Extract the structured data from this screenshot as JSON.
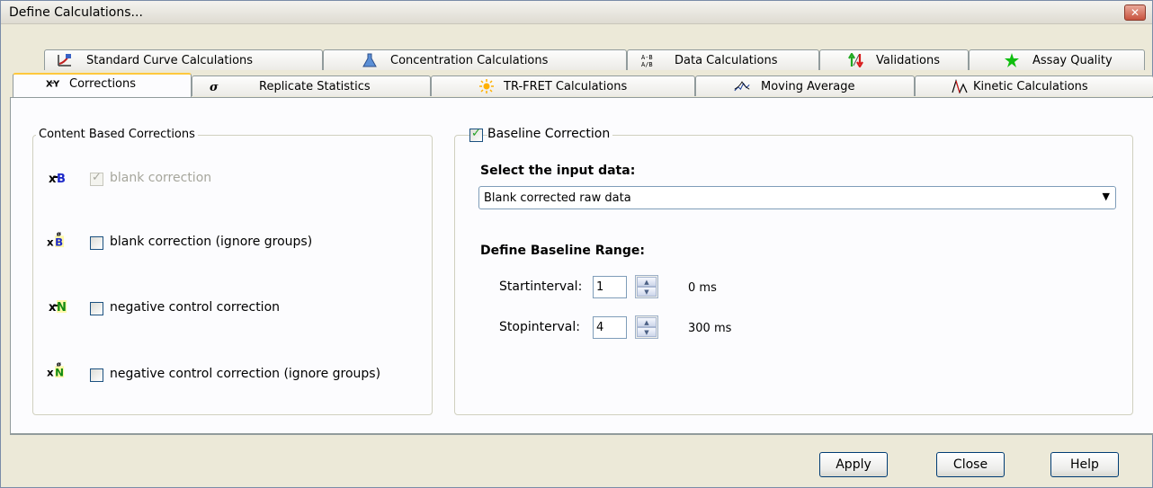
{
  "window": {
    "title": "Define Calculations...",
    "close_glyph": "✕"
  },
  "tabs_row1": [
    {
      "label": "Standard Curve Calculations",
      "icon": "standard-curve-icon"
    },
    {
      "label": "Concentration Calculations",
      "icon": "flask-icon"
    },
    {
      "label": "Data Calculations",
      "icon": "data-calc-icon"
    },
    {
      "label": "Validations",
      "icon": "validations-icon"
    },
    {
      "label": "Assay Quality",
      "icon": "green-star-icon"
    }
  ],
  "tabs_row2": [
    {
      "label": "Corrections",
      "icon": "corrections-icon",
      "active": true
    },
    {
      "label": "Replicate Statistics",
      "icon": "sigma-icon"
    },
    {
      "label": "TR-FRET Calculations",
      "icon": "sun-icon"
    },
    {
      "label": "Moving Average",
      "icon": "moving-average-icon"
    },
    {
      "label": "Kinetic Calculations",
      "icon": "kinetic-icon"
    }
  ],
  "content_corrections": {
    "title": "Content Based Corrections",
    "items": [
      {
        "label": "blank correction",
        "checked": true,
        "disabled": true,
        "icon": "blank-correction-icon"
      },
      {
        "label": "blank correction (ignore groups)",
        "checked": false,
        "disabled": false,
        "icon": "blank-correction-ignore-groups-icon"
      },
      {
        "label": "negative control correction",
        "checked": false,
        "disabled": false,
        "icon": "negative-control-correction-icon"
      },
      {
        "label": "negative control correction (ignore groups)",
        "checked": false,
        "disabled": false,
        "icon": "negative-control-ignore-groups-icon"
      }
    ]
  },
  "baseline": {
    "title": "Baseline Correction",
    "checked": true,
    "input_heading": "Select the input data:",
    "input_value": "Blank corrected raw data",
    "range_heading": "Define Baseline Range:",
    "start_label": "Startinterval:",
    "start_value": "1",
    "start_time": "0 ms",
    "stop_label": "Stopinterval:",
    "stop_value": "4",
    "stop_time": "300 ms"
  },
  "buttons": {
    "apply": "Apply",
    "close": "Close",
    "help": "Help"
  },
  "colors": {
    "accent_tab": "#ffc83c",
    "dialog_bg": "#ece9d8",
    "border": "#919b9c"
  }
}
